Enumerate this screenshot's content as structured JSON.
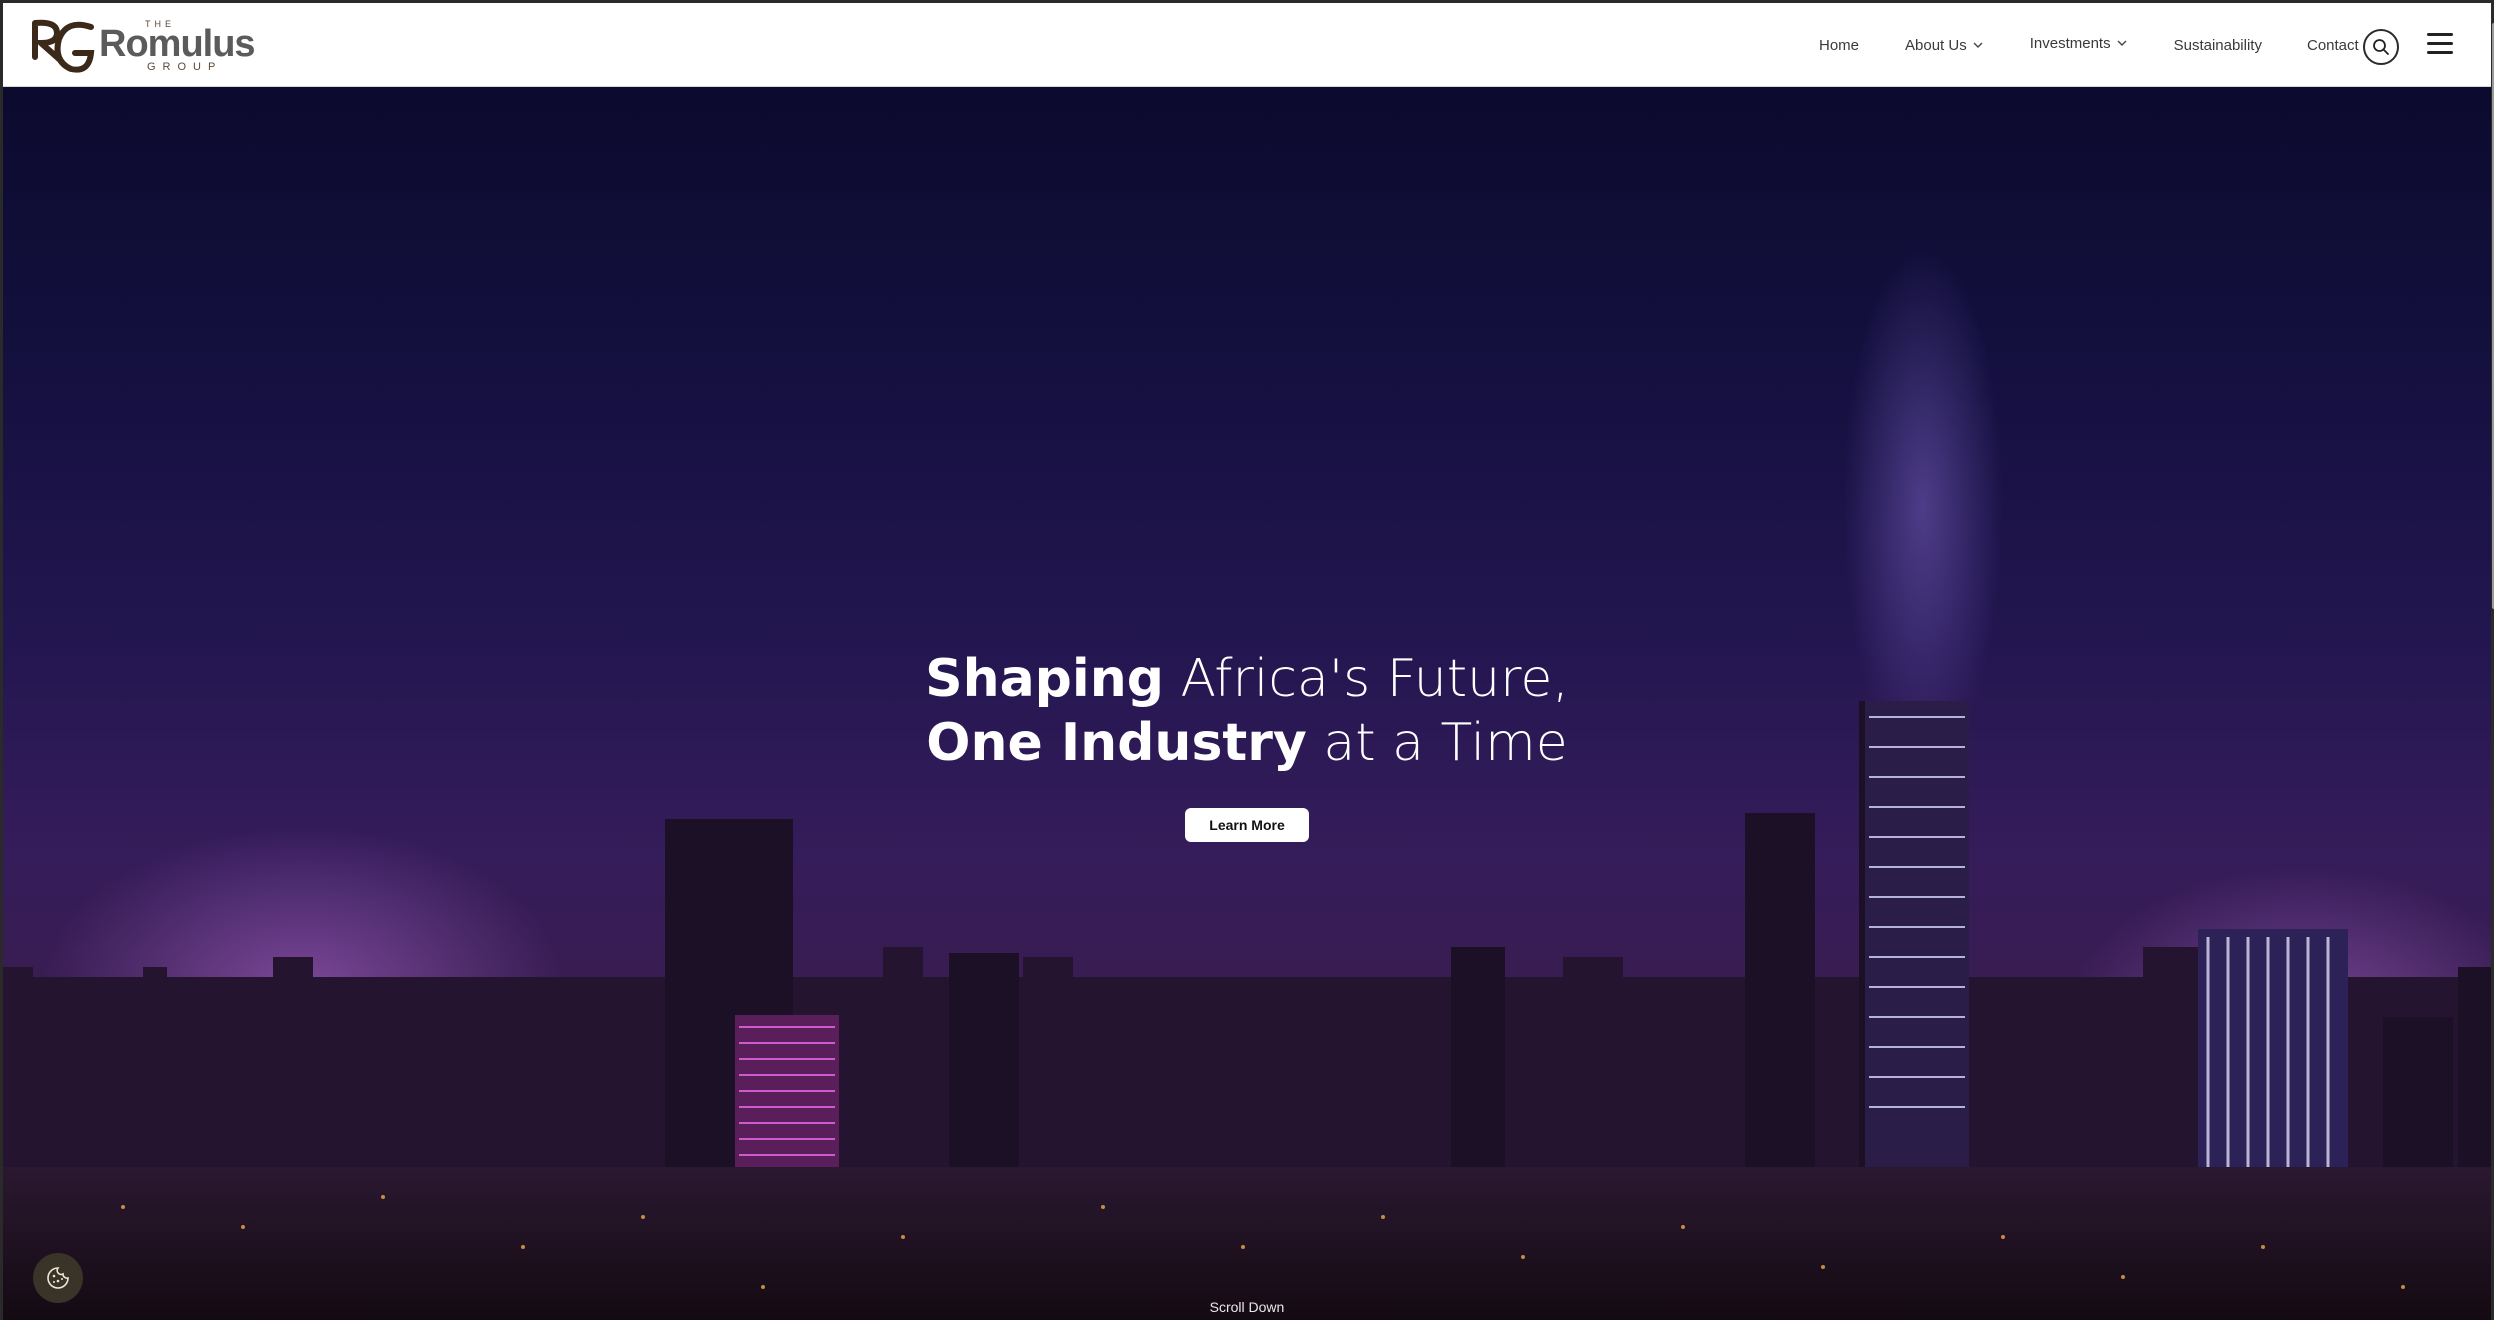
{
  "brand": {
    "the": "THE",
    "name": "Romulus",
    "group": "GROUP",
    "colors": {
      "mark_brown": "#3b2a1a",
      "text_gray": "#5b5b5b"
    }
  },
  "nav": {
    "home": "Home",
    "about": "About Us",
    "investments": "Investments",
    "sustainability": "Sustainability",
    "contact": "Contact"
  },
  "icons": {
    "search": "search-icon",
    "menu": "hamburger-menu-icon",
    "cookie": "cookie-icon",
    "chevron": "chevron-down-icon"
  },
  "hero": {
    "line1_bold": "Shaping",
    "line1_rest": " Africa's Future,",
    "line2_bold": "One Industry",
    "line2_rest": " at a Time",
    "cta": "Learn More",
    "scroll_label": "Scroll Down"
  }
}
